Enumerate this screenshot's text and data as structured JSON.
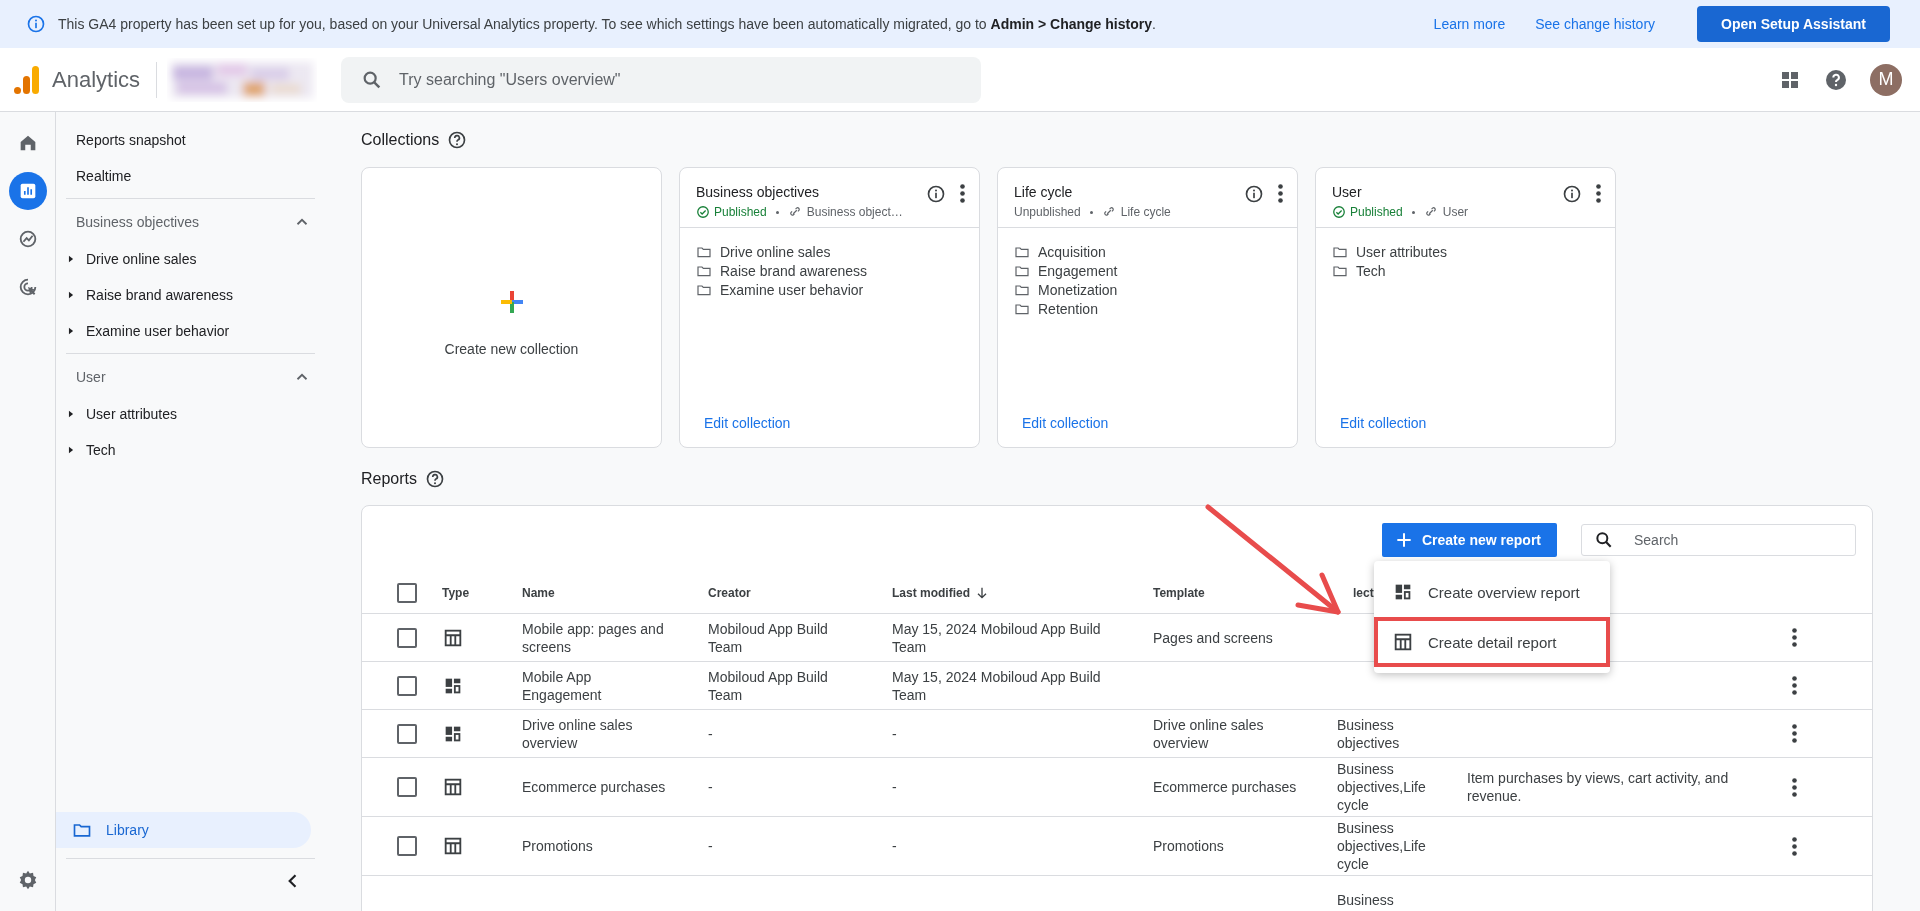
{
  "banner": {
    "text": "This GA4 property has been set up for you, based on your Universal Analytics property. To see which settings have been automatically migrated, go to **Admin > Change history**.",
    "links": [
      "Learn more",
      "See change history"
    ],
    "button": "Open Setup Assistant"
  },
  "header": {
    "product": "Analytics",
    "search_placeholder": "Try searching \"Users overview\"",
    "avatar": "M"
  },
  "rail": [
    {
      "kind": "home",
      "selected": false
    },
    {
      "kind": "reports",
      "selected": true
    },
    {
      "kind": "explore",
      "selected": false
    },
    {
      "kind": "advertising",
      "selected": false
    }
  ],
  "sidebar": {
    "top_items": [
      "Reports snapshot",
      "Realtime"
    ],
    "sections": [
      {
        "title": "Business objectives",
        "expanded": true,
        "children": [
          {
            "label": "Drive online sales"
          },
          {
            "label": "Raise brand awareness"
          },
          {
            "label": "Examine user behavior"
          }
        ]
      },
      {
        "title": "User",
        "expanded": true,
        "children": [
          {
            "label": "User attributes"
          },
          {
            "label": "Tech"
          }
        ]
      }
    ],
    "library": {
      "label": "Library",
      "selected": true
    }
  },
  "collections": {
    "title": "Collections",
    "create_label": "Create new collection",
    "cards": [
      {
        "title": "Business objectives",
        "status": "Published",
        "published": true,
        "template": "Business object…",
        "items": [
          "Drive online sales",
          "Raise brand awareness",
          "Examine user behavior"
        ],
        "action": "Edit collection"
      },
      {
        "title": "Life cycle",
        "status": "Unpublished",
        "published": false,
        "template": "Life cycle",
        "items": [
          "Acquisition",
          "Engagement",
          "Monetization",
          "Retention"
        ],
        "action": "Edit collection"
      },
      {
        "title": "User",
        "status": "Published",
        "published": true,
        "template": "User",
        "items": [
          "User attributes",
          "Tech"
        ],
        "action": "Edit collection"
      }
    ]
  },
  "reports": {
    "title": "Reports",
    "select_all": {
      "checked": false
    },
    "create_button": "Create new report",
    "search_placeholder": "Search",
    "menu": [
      {
        "kind": "overview",
        "label": "Create overview report",
        "highlighted": false
      },
      {
        "kind": "detail",
        "label": "Create detail report",
        "highlighted": true
      }
    ],
    "columns": [
      {
        "label": "Type",
        "sorted": false
      },
      {
        "label": "Name",
        "sorted": false
      },
      {
        "label": "Creator",
        "sorted": false
      },
      {
        "label": "Last modified",
        "sorted": true
      },
      {
        "label": "Template",
        "sorted": false
      },
      {
        "label": "lect"
      }
    ],
    "rows": [
      {
        "kind": "detail",
        "checked": false,
        "name": "Mobile app: pages and screens",
        "creator": "Mobiloud App Build Team",
        "last_modified": "May 15, 2024 Mobiloud App Build Team",
        "template": "Pages and screens"
      },
      {
        "kind": "overview",
        "checked": false,
        "name": "Mobile App Engagement",
        "creator": "Mobiloud App Build Team",
        "last_modified": "May 15, 2024 Mobiloud App Build Team"
      },
      {
        "kind": "overview",
        "checked": false,
        "name": "Drive online sales overview",
        "creator": "-",
        "last_modified": "-",
        "template": "Drive online sales overview",
        "collections": "Business objectives"
      },
      {
        "kind": "detail",
        "checked": false,
        "name": "Ecommerce purchases",
        "creator": "-",
        "last_modified": "-",
        "template": "Ecommerce purchases",
        "collections": "Business objectives,Life cycle",
        "description": "Item purchases by views, cart activity, and revenue."
      },
      {
        "kind": "detail",
        "checked": false,
        "name": "Promotions",
        "creator": "-",
        "last_modified": "-",
        "template": "Promotions",
        "collections": "Business objectives,Life cycle"
      },
      {
        "collections": "Business"
      }
    ]
  }
}
